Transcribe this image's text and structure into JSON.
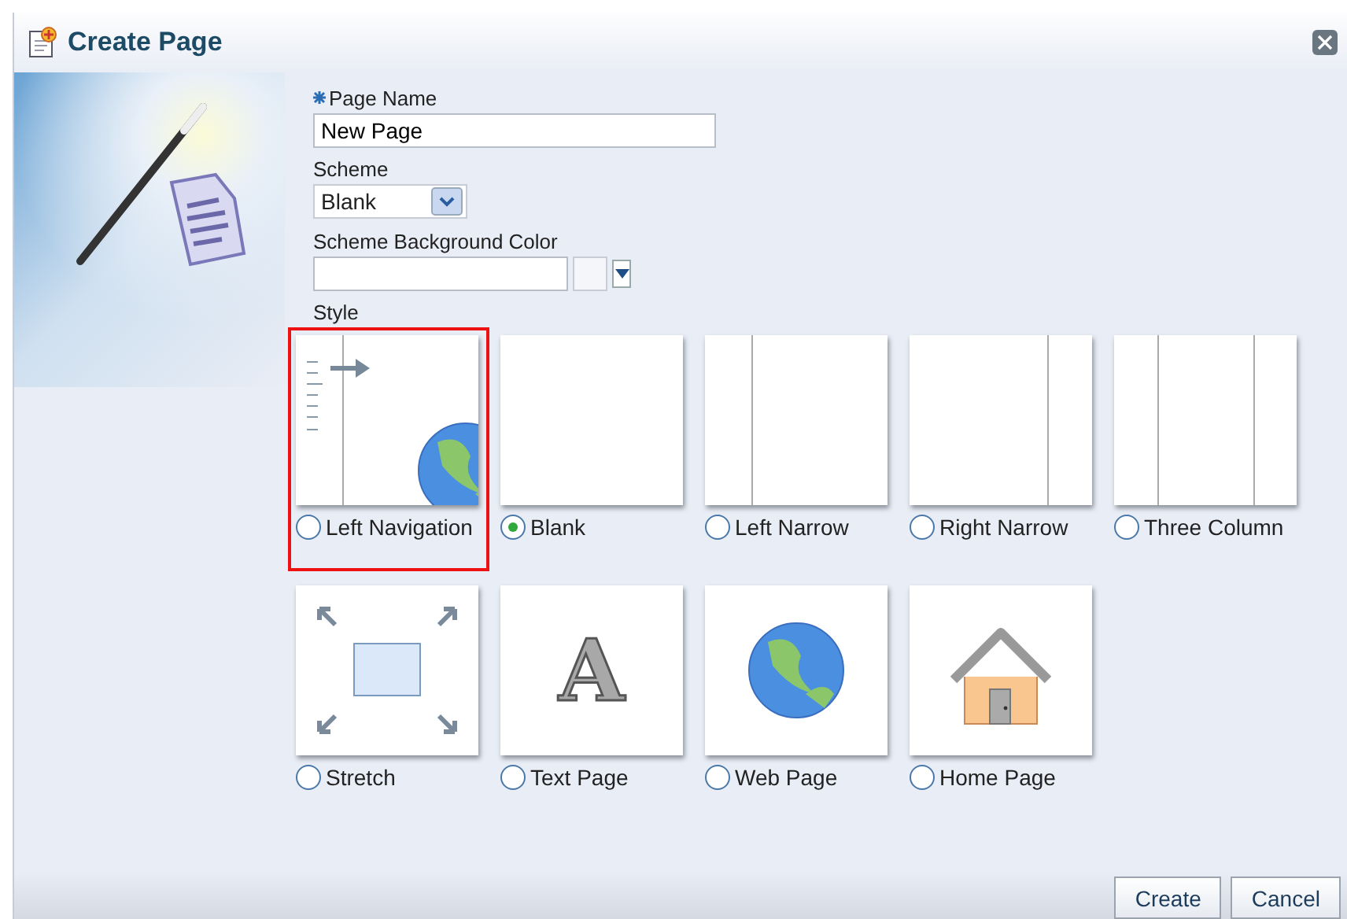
{
  "window": {
    "title": "Create Page"
  },
  "form": {
    "page_name": {
      "label": "Page Name",
      "required": true,
      "value": "New Page"
    },
    "scheme": {
      "label": "Scheme",
      "value": "Blank"
    },
    "scheme_background_color": {
      "label": "Scheme Background Color"
    },
    "style_label": "Style"
  },
  "styles": [
    {
      "kind": "left-navigation",
      "label": "Left Navigation",
      "selected": false,
      "highlighted": true
    },
    {
      "kind": "blank",
      "label": "Blank",
      "selected": true,
      "highlighted": false
    },
    {
      "kind": "left-narrow",
      "label": "Left Narrow",
      "selected": false,
      "highlighted": false
    },
    {
      "kind": "right-narrow",
      "label": "Right Narrow",
      "selected": false,
      "highlighted": false
    },
    {
      "kind": "three-column",
      "label": "Three Column",
      "selected": false,
      "highlighted": false
    },
    {
      "kind": "stretch",
      "label": "Stretch",
      "selected": false,
      "highlighted": false
    },
    {
      "kind": "text",
      "label": "Text Page",
      "glyph": "A",
      "selected": false,
      "highlighted": false
    },
    {
      "kind": "web",
      "label": "Web Page",
      "selected": false,
      "highlighted": false
    },
    {
      "kind": "home",
      "label": "Home Page",
      "selected": false,
      "highlighted": false
    }
  ],
  "buttons": [
    "Create",
    "Cancel"
  ]
}
